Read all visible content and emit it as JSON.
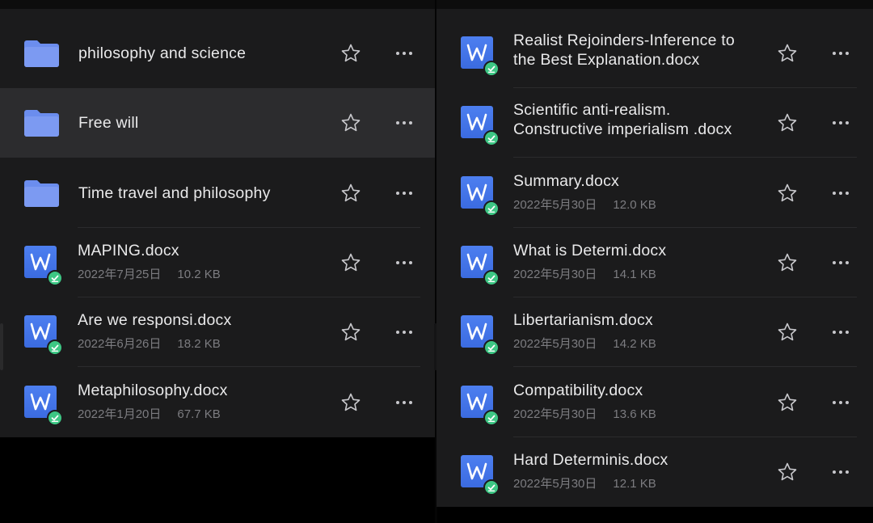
{
  "colors": {
    "background": "#000000",
    "pane": "#1b1b1c",
    "selected_row": "#2c2c2e",
    "folder": "#6b8dee",
    "word_icon": "#3b6be0",
    "sync_badge": "#3dc784",
    "title_text": "#e9e9ea",
    "meta_text": "#7c7c80"
  },
  "left_pane": {
    "items": [
      {
        "type": "folder",
        "icon": "folder-icon",
        "title": "philosophy and science",
        "date": "",
        "size": "",
        "selected": false
      },
      {
        "type": "folder",
        "icon": "folder-icon",
        "title": "Free will",
        "date": "",
        "size": "",
        "selected": true
      },
      {
        "type": "folder",
        "icon": "folder-icon",
        "title": "Time travel and philosophy",
        "date": "",
        "size": "",
        "selected": false
      },
      {
        "type": "doc",
        "icon": "word-doc-icon",
        "title": "MAPING.docx",
        "date": "2022年7月25日",
        "size": "10.2 KB",
        "selected": false
      },
      {
        "type": "doc",
        "icon": "word-doc-icon",
        "title": "Are we responsi.docx",
        "date": "2022年6月26日",
        "size": "18.2 KB",
        "selected": false
      },
      {
        "type": "doc",
        "icon": "word-doc-icon",
        "title": "Metaphilosophy.docx",
        "date": "2022年1月20日",
        "size": "67.7 KB",
        "selected": false
      }
    ]
  },
  "right_pane": {
    "items": [
      {
        "type": "doc",
        "icon": "word-doc-icon",
        "title": "Realist Rejoinders-Inference to the Best Explanation.docx",
        "date": "",
        "size": "",
        "selected": false
      },
      {
        "type": "doc",
        "icon": "word-doc-icon",
        "title": "Scientific anti-realism. Constructive imperialism .docx",
        "date": "",
        "size": "",
        "selected": false
      },
      {
        "type": "doc",
        "icon": "word-doc-icon",
        "title": "Summary.docx",
        "date": "2022年5月30日",
        "size": "12.0 KB",
        "selected": false
      },
      {
        "type": "doc",
        "icon": "word-doc-icon",
        "title": "What is Determi.docx",
        "date": "2022年5月30日",
        "size": "14.1 KB",
        "selected": false
      },
      {
        "type": "doc",
        "icon": "word-doc-icon",
        "title": "Libertarianism.docx",
        "date": "2022年5月30日",
        "size": "14.2 KB",
        "selected": false
      },
      {
        "type": "doc",
        "icon": "word-doc-icon",
        "title": "Compatibility.docx",
        "date": "2022年5月30日",
        "size": "13.6 KB",
        "selected": false
      },
      {
        "type": "doc",
        "icon": "word-doc-icon",
        "title": "Hard Determinis.docx",
        "date": "2022年5月30日",
        "size": "12.1 KB",
        "selected": false
      }
    ]
  },
  "row_actions": {
    "star_icon": "star-icon",
    "more_icon": "more-icon"
  }
}
